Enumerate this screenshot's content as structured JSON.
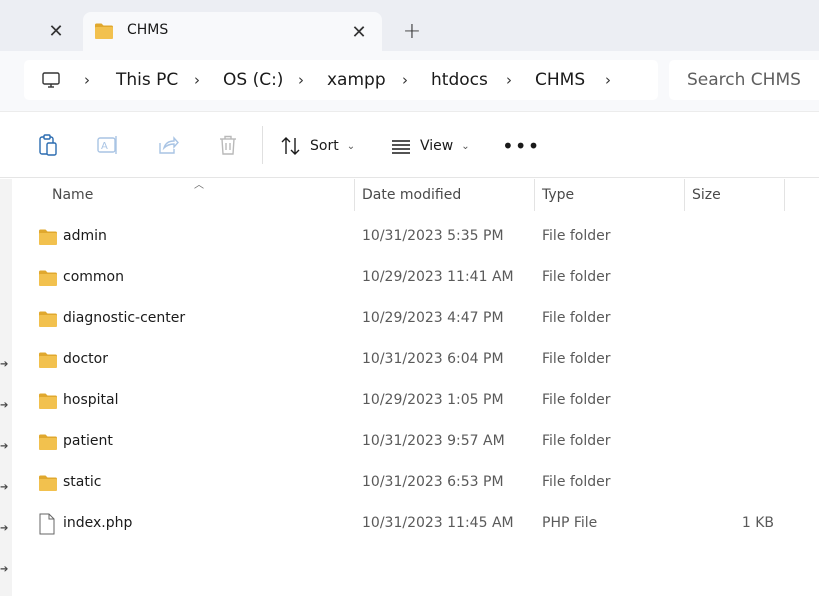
{
  "window": {
    "tabs": [
      {
        "title": "",
        "icon": "close-icon"
      },
      {
        "title": "CHMS",
        "icon": "folder-icon",
        "active": true
      }
    ],
    "new_tab_label": "+"
  },
  "address": {
    "breadcrumb": [
      "This PC",
      "OS (C:)",
      "xampp",
      "htdocs",
      "CHMS"
    ]
  },
  "search": {
    "placeholder": "Search CHMS"
  },
  "toolbar": {
    "sort_label": "Sort",
    "view_label": "View",
    "more_label": "•••"
  },
  "columns": {
    "name": "Name",
    "date": "Date modified",
    "type": "Type",
    "size": "Size"
  },
  "files": [
    {
      "name": "admin",
      "date": "10/31/2023 5:35 PM",
      "type": "File folder",
      "size": "",
      "kind": "folder"
    },
    {
      "name": "common",
      "date": "10/29/2023 11:41 AM",
      "type": "File folder",
      "size": "",
      "kind": "folder"
    },
    {
      "name": "diagnostic-center",
      "date": "10/29/2023 4:47 PM",
      "type": "File folder",
      "size": "",
      "kind": "folder"
    },
    {
      "name": "doctor",
      "date": "10/31/2023 6:04 PM",
      "type": "File folder",
      "size": "",
      "kind": "folder"
    },
    {
      "name": "hospital",
      "date": "10/29/2023 1:05 PM",
      "type": "File folder",
      "size": "",
      "kind": "folder"
    },
    {
      "name": "patient",
      "date": "10/31/2023 9:57 AM",
      "type": "File folder",
      "size": "",
      "kind": "folder"
    },
    {
      "name": "static",
      "date": "10/31/2023 6:53 PM",
      "type": "File folder",
      "size": "",
      "kind": "folder"
    },
    {
      "name": "index.php",
      "date": "10/31/2023 11:45 AM",
      "type": "PHP File",
      "size": "1 KB",
      "kind": "file"
    }
  ],
  "colors": {
    "folder": "#f2c14e",
    "folder_dark": "#e0a82e",
    "tabstrip_bg": "#eceef3",
    "addressbar_bg": "#f8f9fb"
  }
}
